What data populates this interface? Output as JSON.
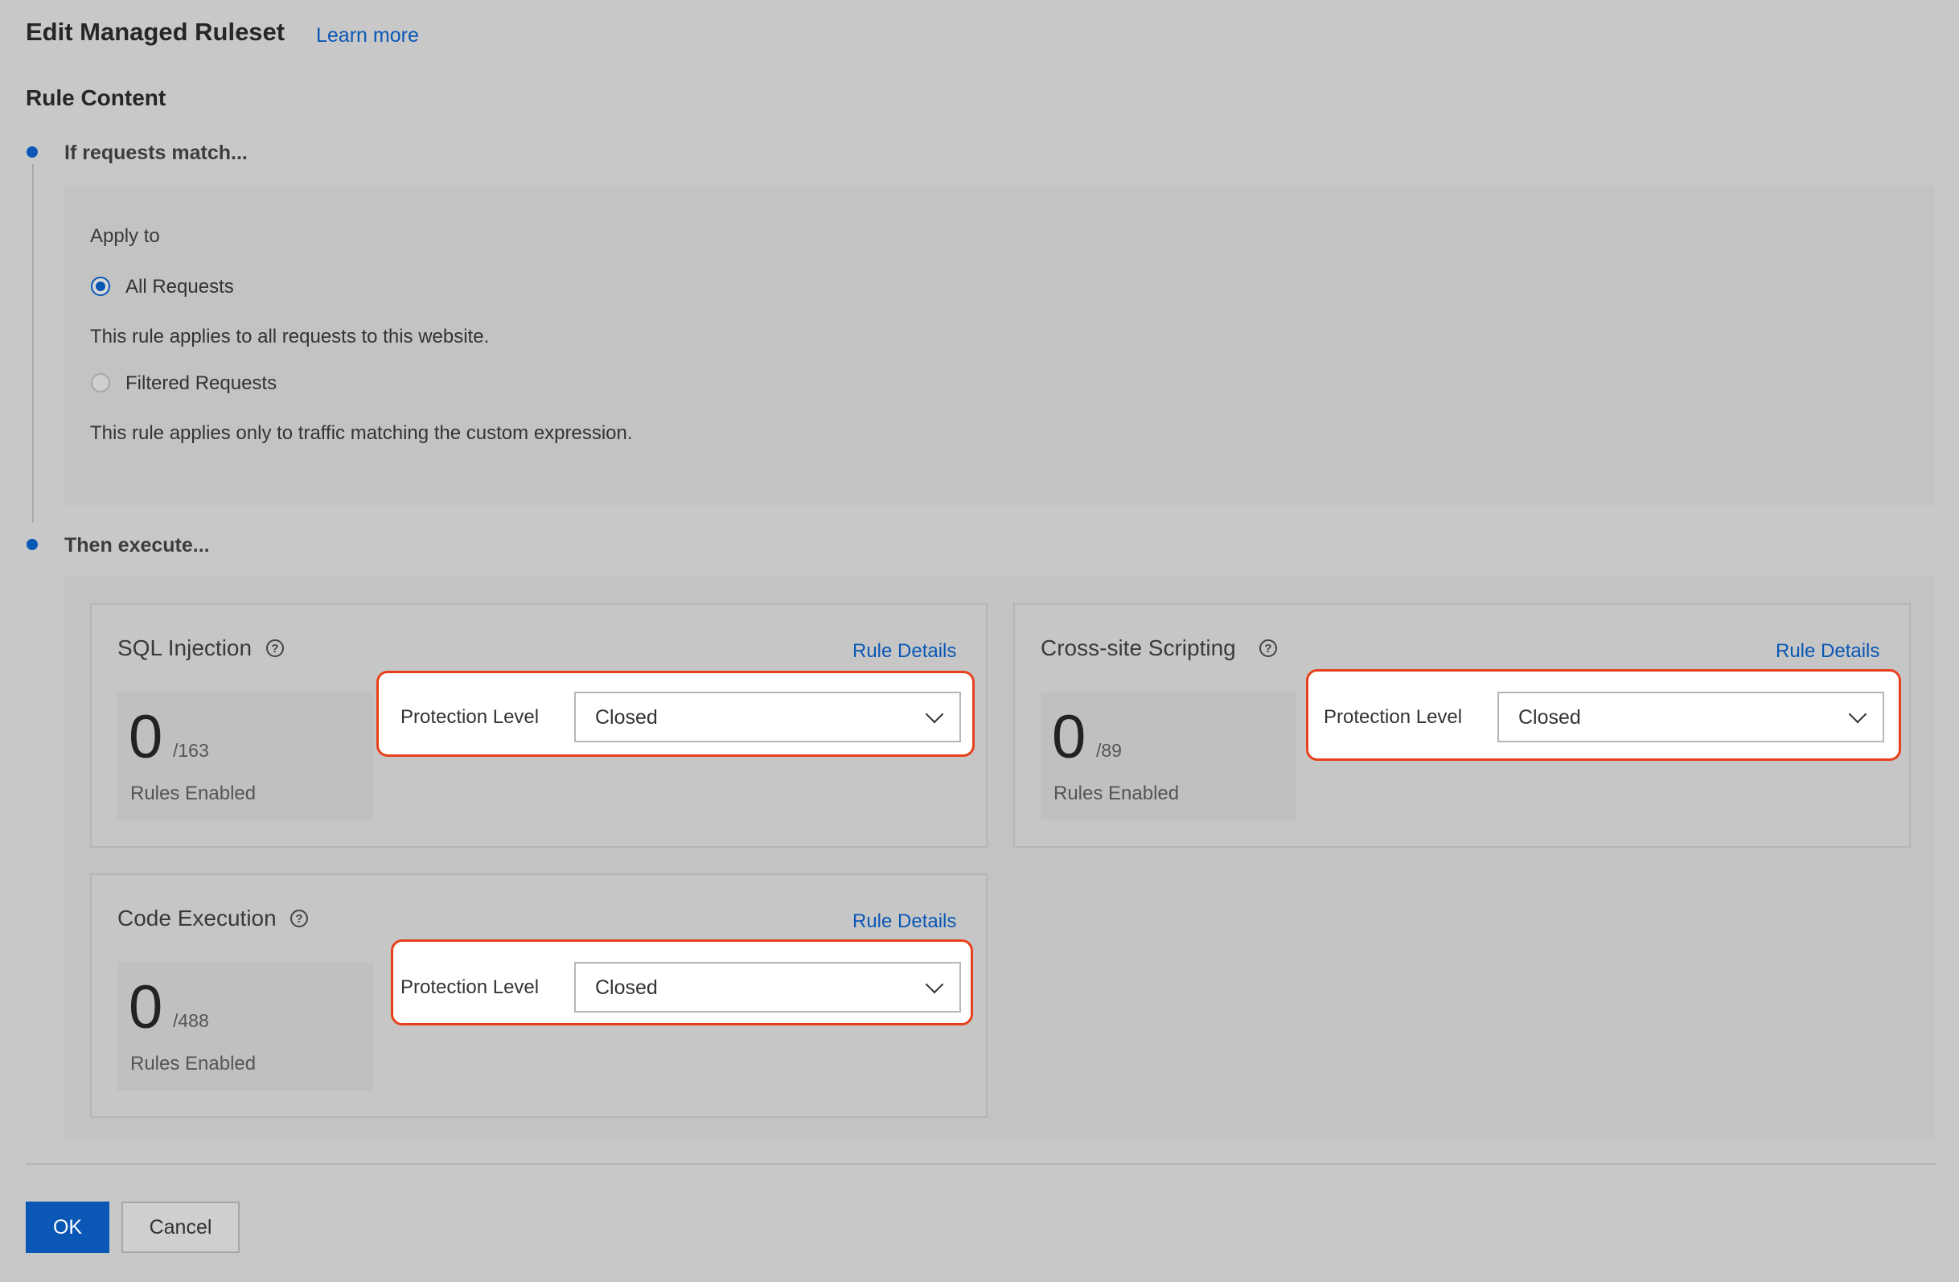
{
  "header": {
    "title": "Edit Managed Ruleset",
    "learn_more": "Learn more"
  },
  "rule_content": {
    "title": "Rule Content"
  },
  "condition": {
    "step_label": "If requests match...",
    "apply_to_label": "Apply to",
    "options": [
      {
        "label": "All Requests",
        "selected": true,
        "description": "This rule applies to all requests to this website."
      },
      {
        "label": "Filtered Requests",
        "selected": false,
        "description": "This rule applies only to traffic matching the custom expression."
      }
    ]
  },
  "action": {
    "step_label": "Then execute...",
    "cards": [
      {
        "title": "SQL Injection",
        "details_label": "Rule Details",
        "enabled": "0",
        "total": "/163",
        "enabled_label": "Rules Enabled",
        "protection_label": "Protection Level",
        "protection_value": "Closed"
      },
      {
        "title": "Cross-site Scripting",
        "details_label": "Rule Details",
        "enabled": "0",
        "total": "/89",
        "enabled_label": "Rules Enabled",
        "protection_label": "Protection Level",
        "protection_value": "Closed"
      },
      {
        "title": "Code Execution",
        "details_label": "Rule Details",
        "enabled": "0",
        "total": "/488",
        "enabled_label": "Rules Enabled",
        "protection_label": "Protection Level",
        "protection_value": "Closed"
      }
    ]
  },
  "footer": {
    "ok_label": "OK",
    "cancel_label": "Cancel"
  },
  "colors": {
    "accent": "#0a57b5",
    "highlight": "#e8401c",
    "background": "#c8c8c8"
  },
  "icons": [
    "help-icon",
    "chevron-down-icon",
    "step-dot-icon"
  ]
}
